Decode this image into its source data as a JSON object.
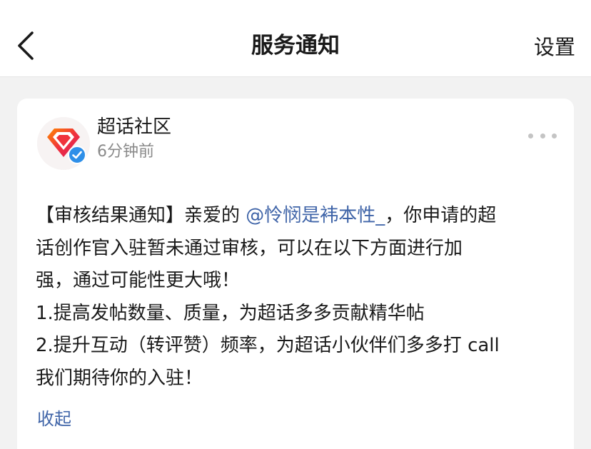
{
  "nav": {
    "title": "服务通知",
    "settings_label": "设置"
  },
  "message": {
    "author": "超话社区",
    "time": "6分钟前",
    "mention": "@怜悯是袆本性_",
    "lines": {
      "l1_pre": "【审核结果通知】亲爱的 ",
      "l1_post": "，你申请的超",
      "l2": "话创作官入驻暂未通过审核，可以在以下方面进行加",
      "l3": "强，通过可能性更大哦！",
      "l4": "1.提高发帖数量、质量，为超话多多贡献精华帖",
      "l5": "2.提升互动（转评赞）频率，为超话小伙伴们多多打 call",
      "l6": "我们期待你的入驻！"
    },
    "collapse_label": "收起"
  },
  "colors": {
    "link": "#3f64a8",
    "verified_badge": "#2e8fe8",
    "logo_red": "#f0323c",
    "logo_orange": "#ff8a00"
  },
  "icons": {
    "back": "chevron-left-icon",
    "more": "more-dots-icon",
    "verified": "verified-badge-icon",
    "avatar": "supertopic-diamond-logo"
  }
}
